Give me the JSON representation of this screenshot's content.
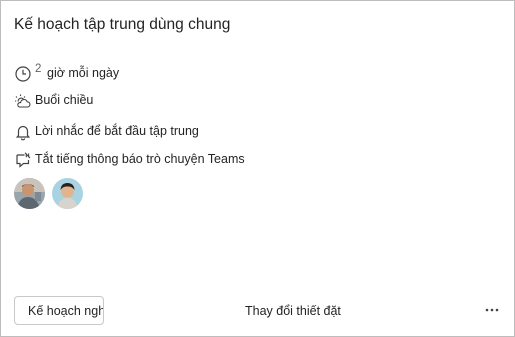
{
  "card": {
    "title": "Kế hoạch tập trung dùng chung",
    "hours": {
      "value": "2",
      "label": "giờ mỗi ngày",
      "icon": "clock-icon"
    },
    "time_of_day": {
      "label": "Buổi chiều",
      "icon": "weather-partly-cloudy-icon"
    },
    "reminder": {
      "label": "Lời nhắc để bắt đầu tập trung",
      "icon": "bell-icon"
    },
    "mute": {
      "label": "Tắt tiếng thông báo trò chuyện Teams",
      "icon": "chat-mute-icon"
    },
    "participants": [
      {
        "icon": "avatar-person-1"
      },
      {
        "icon": "avatar-person-2"
      }
    ]
  },
  "footer": {
    "plan_button": "Kế hoạch nghỉ",
    "change_settings": "Thay đổi thiết đặt",
    "more_icon": "more-horizontal-icon"
  }
}
